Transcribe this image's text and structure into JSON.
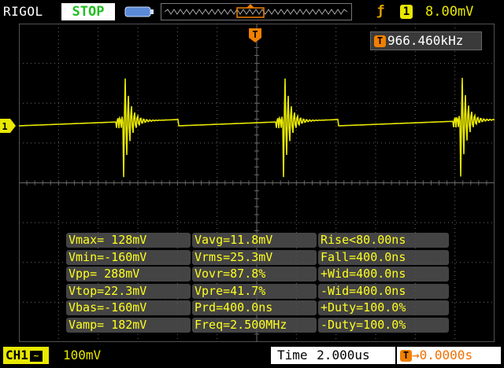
{
  "header": {
    "brand": "RIGOL",
    "run_status": "STOP",
    "trigger": {
      "edge_icon": "rising-edge-icon",
      "source": "1",
      "level": "8.00mV"
    }
  },
  "frequency_readout": "966.460kHz",
  "trigger_position_marker": "T",
  "channel_marker": "1",
  "measurements": [
    [
      "Vmax= 128mV",
      "Vavg=11.8mV",
      "Rise<80.00ns"
    ],
    [
      "Vmin=-160mV",
      "Vrms=25.3mV",
      "Fall=400.0ns"
    ],
    [
      "Vpp= 288mV",
      "Vovr=87.8%",
      "+Wid=400.0ns"
    ],
    [
      "Vtop=22.3mV",
      "Vpre=41.7%",
      "-Wid=400.0ns"
    ],
    [
      "Vbas=-160mV",
      "Prd=400.0ns",
      "+Duty=100.0%"
    ],
    [
      "Vamp= 182mV",
      "Freq=2.500MHz",
      "-Duty=100.0%"
    ]
  ],
  "footer": {
    "channel_label": "CH1",
    "coupling_icon": "ac-coupling-icon",
    "coupling_symbol": "~",
    "volts_per_div": "100mV",
    "time_label": "Time",
    "time_per_div": "2.000us",
    "trigger_delay": "0.0000s"
  },
  "colors": {
    "trace": "#e8e800",
    "grid": "#6a6a6a",
    "accent": "#f08000"
  }
}
